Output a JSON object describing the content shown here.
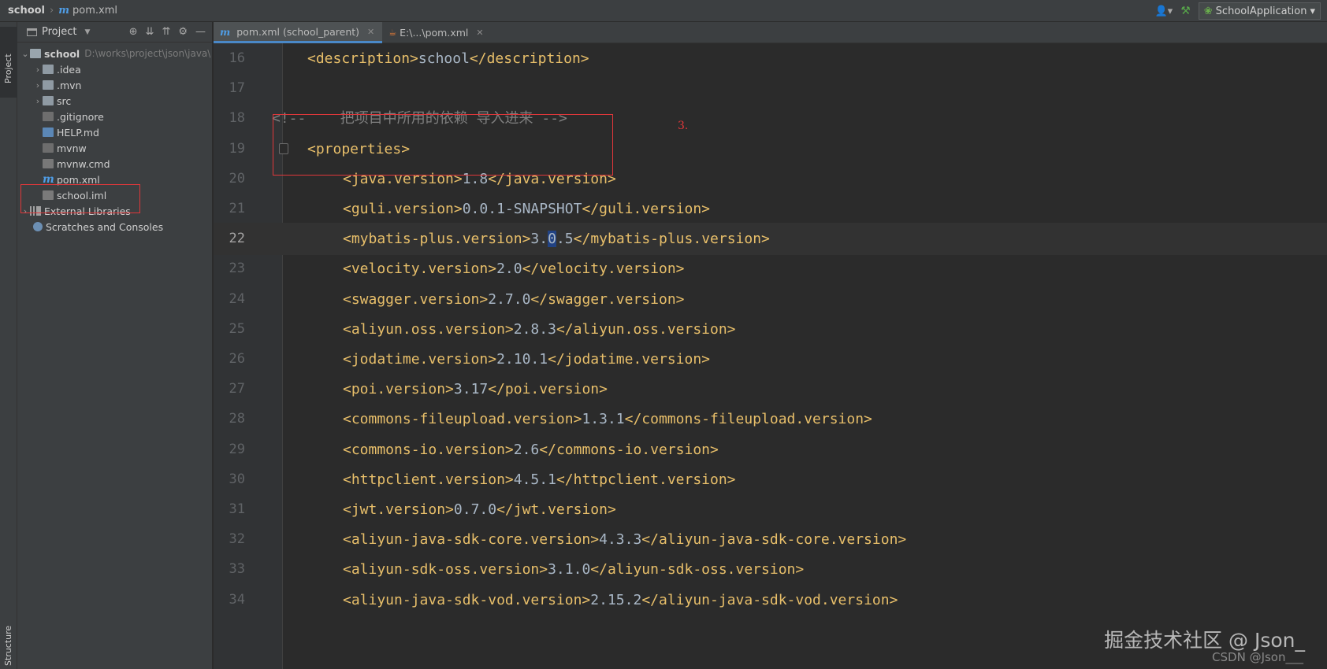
{
  "breadcrumb": {
    "project": "school",
    "file": "pom.xml"
  },
  "toolbar": {
    "run_config": "SchoolApplication"
  },
  "left_strip": {
    "project_tab": "Project",
    "structure_tab": "Structure"
  },
  "project_panel": {
    "title": "Project",
    "tree": [
      {
        "label": "school",
        "path": "D:\\works\\project\\json\\java\\"
      },
      {
        "label": ".idea"
      },
      {
        "label": ".mvn"
      },
      {
        "label": "src"
      },
      {
        "label": ".gitignore"
      },
      {
        "label": "HELP.md"
      },
      {
        "label": "mvnw"
      },
      {
        "label": "mvnw.cmd"
      },
      {
        "label": "pom.xml"
      },
      {
        "label": "school.iml"
      },
      {
        "label": "External Libraries"
      },
      {
        "label": "Scratches and Consoles"
      }
    ]
  },
  "editor_tabs": [
    {
      "label": "pom.xml (school_parent)",
      "active": true
    },
    {
      "label": "E:\\...\\pom.xml",
      "active": false
    }
  ],
  "editor": {
    "current_line": 22,
    "lines": [
      {
        "n": "16",
        "indent": 1,
        "open": "<description>",
        "value": "school",
        "close": "</description>"
      },
      {
        "n": "17",
        "indent": 0,
        "open": "",
        "value": "",
        "close": ""
      },
      {
        "n": "18",
        "indent": 0,
        "comment": "<!--    把项目中所用的依赖 导入进来 -->"
      },
      {
        "n": "19",
        "indent": 1,
        "open": "<properties>",
        "value": "",
        "close": ""
      },
      {
        "n": "20",
        "indent": 2,
        "open": "<java.version>",
        "value": "1.8",
        "close": "</java.version>"
      },
      {
        "n": "21",
        "indent": 2,
        "open": "<guli.version>",
        "value": "0.0.1-SNAPSHOT",
        "close": "</guli.version>"
      },
      {
        "n": "22",
        "indent": 2,
        "open": "<mybatis-plus.version>",
        "value_a": "3.",
        "value_caret": "0",
        "value_b": ".5",
        "close": "</mybatis-plus.version>"
      },
      {
        "n": "23",
        "indent": 2,
        "open": "<velocity.version>",
        "value": "2.0",
        "close": "</velocity.version>"
      },
      {
        "n": "24",
        "indent": 2,
        "open": "<swagger.version>",
        "value": "2.7.0",
        "close": "</swagger.version>"
      },
      {
        "n": "25",
        "indent": 2,
        "open": "<aliyun.oss.version>",
        "value": "2.8.3",
        "close": "</aliyun.oss.version>"
      },
      {
        "n": "26",
        "indent": 2,
        "open": "<jodatime.version>",
        "value": "2.10.1",
        "close": "</jodatime.version>"
      },
      {
        "n": "27",
        "indent": 2,
        "open": "<poi.version>",
        "value": "3.17",
        "close": "</poi.version>"
      },
      {
        "n": "28",
        "indent": 2,
        "open": "<commons-fileupload.version>",
        "value": "1.3.1",
        "close": "</commons-fileupload.version>"
      },
      {
        "n": "29",
        "indent": 2,
        "open": "<commons-io.version>",
        "value": "2.6",
        "close": "</commons-io.version>"
      },
      {
        "n": "30",
        "indent": 2,
        "open": "<httpclient.version>",
        "value": "4.5.1",
        "close": "</httpclient.version>"
      },
      {
        "n": "31",
        "indent": 2,
        "open": "<jwt.version>",
        "value": "0.7.0",
        "close": "</jwt.version>"
      },
      {
        "n": "32",
        "indent": 2,
        "open": "<aliyun-java-sdk-core.version>",
        "value": "4.3.3",
        "close": "</aliyun-java-sdk-core.version>"
      },
      {
        "n": "33",
        "indent": 2,
        "open": "<aliyun-sdk-oss.version>",
        "value": "3.1.0",
        "close": "</aliyun-sdk-oss.version>"
      },
      {
        "n": "34",
        "indent": 2,
        "open": "<aliyun-java-sdk-vod.version>",
        "value": "2.15.2",
        "close": "</aliyun-java-sdk-vod.version>"
      }
    ]
  },
  "annotation": {
    "step": "3."
  },
  "watermark": {
    "main": "掘金技术社区 @ Json_",
    "sub": "CSDN @Json___"
  }
}
